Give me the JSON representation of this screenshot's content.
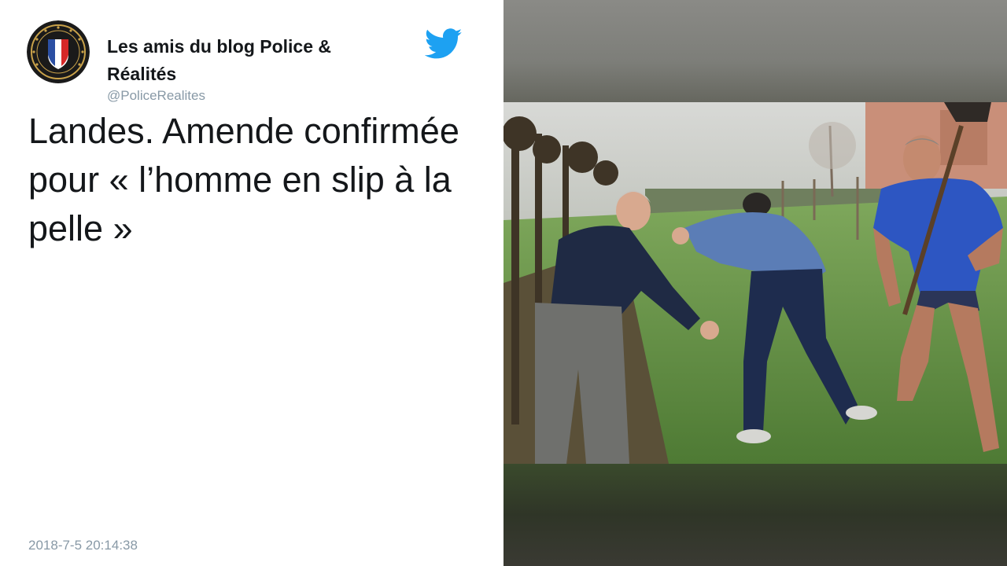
{
  "tweet": {
    "author_name": "Les amis du blog Police & Réalités",
    "handle": "@PoliceRealites",
    "text": "Landes. Amende confirmée pour « l’homme en slip à la pelle »",
    "timestamp": "2018-7-5 20:14:38"
  },
  "icons": {
    "avatar": "police-badge-avatar",
    "brand": "twitter-bird-icon"
  },
  "colors": {
    "text_primary": "#14171a",
    "text_secondary": "#8899a6",
    "twitter_blue": "#1da1f2",
    "background": "#ffffff"
  }
}
